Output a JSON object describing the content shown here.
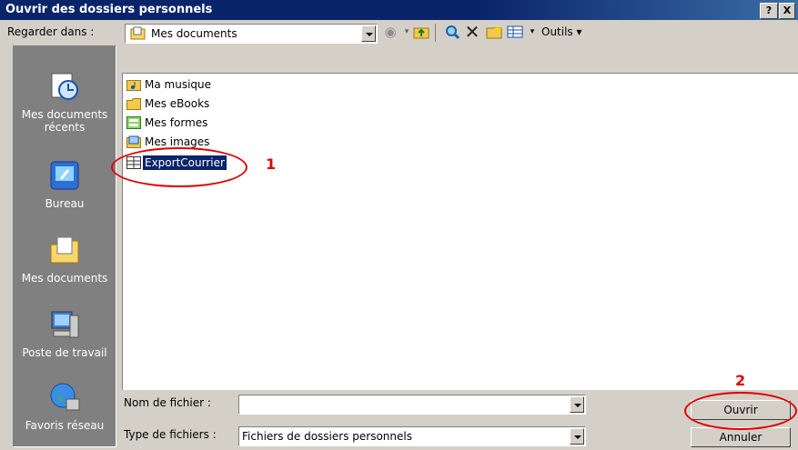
{
  "window": {
    "title": "Ouvrir des dossiers personnels",
    "help_label": "?",
    "close_label": "X"
  },
  "lookin": {
    "label": "Regarder dans :",
    "value": "Mes documents"
  },
  "toolbar": {
    "tools_label": "Outils"
  },
  "places": [
    {
      "label": "Mes documents récents",
      "icon": "recent-documents-icon"
    },
    {
      "label": "Bureau",
      "icon": "desktop-icon"
    },
    {
      "label": "Mes documents",
      "icon": "my-documents-icon"
    },
    {
      "label": "Poste de travail",
      "icon": "my-computer-icon"
    },
    {
      "label": "Favoris réseau",
      "icon": "network-places-icon"
    }
  ],
  "files": [
    {
      "name": "Ma musique",
      "icon": "music-folder-icon"
    },
    {
      "name": "Mes eBooks",
      "icon": "folder-icon"
    },
    {
      "name": "Mes formes",
      "icon": "shapes-folder-icon"
    },
    {
      "name": "Mes images",
      "icon": "pictures-folder-icon"
    },
    {
      "name": "ExportCourrier",
      "icon": "pst-file-icon",
      "selected": true
    }
  ],
  "filename": {
    "label": "Nom de fichier :",
    "value": ""
  },
  "filetype": {
    "label": "Type de fichiers :",
    "value": "Fichiers de dossiers personnels"
  },
  "buttons": {
    "open": "Ouvrir",
    "cancel": "Annuler"
  },
  "annotations": {
    "step1": "1",
    "step2": "2"
  },
  "colors": {
    "annotation": "#e00000",
    "selection": "#0a246a",
    "titlebar": "#0a246a"
  }
}
